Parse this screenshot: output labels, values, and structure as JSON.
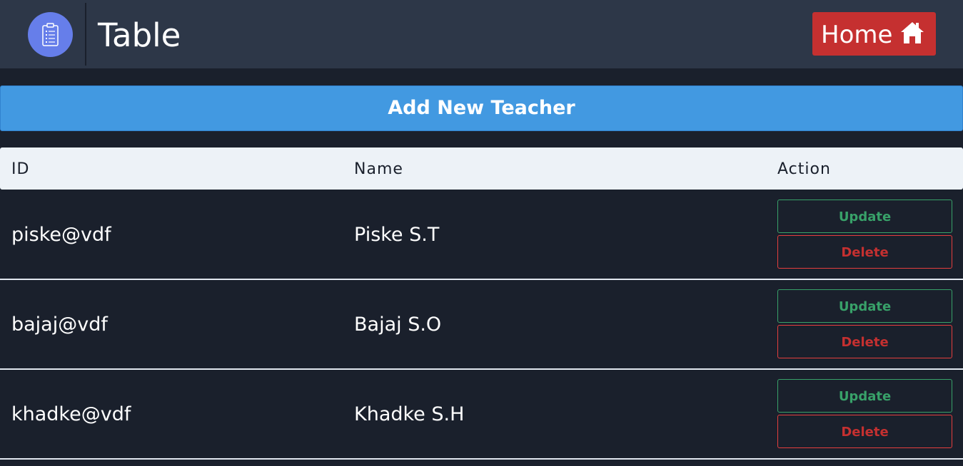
{
  "header": {
    "title": "Table",
    "logo_icon": "clipboard-icon",
    "home_label": "Home",
    "home_icon": "home-icon",
    "colors": {
      "bar": "#2d3748",
      "logo": "#667eea",
      "home": "#c53030"
    }
  },
  "add_button": {
    "label": "Add New Teacher",
    "color": "#4299e1"
  },
  "table": {
    "columns": [
      "ID",
      "Name",
      "Action"
    ],
    "rows": [
      {
        "id": "piske@vdf",
        "name": "Piske S.T",
        "update": "Update",
        "delete": "Delete"
      },
      {
        "id": "bajaj@vdf",
        "name": "Bajaj S.O",
        "update": "Update",
        "delete": "Delete"
      },
      {
        "id": "khadke@vdf",
        "name": "Khadke S.H",
        "update": "Update",
        "delete": "Delete"
      }
    ]
  }
}
